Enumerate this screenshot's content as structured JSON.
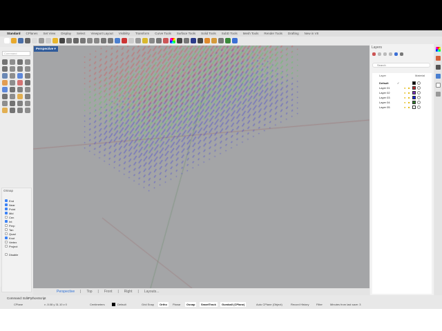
{
  "tabs": [
    "Standard",
    "CPlanes",
    "Set View",
    "Display",
    "Select",
    "Viewport Layout",
    "Visibility",
    "Transform",
    "Curve Tools",
    "Surface Tools",
    "Solid Tools",
    "SubD Tools",
    "Mesh Tools",
    "Render Tools",
    "Drafting",
    "New in V8"
  ],
  "command_placeholder": "Command",
  "viewport": {
    "label": "Perspective ▾",
    "tabs": [
      "Perspective",
      "Top",
      "Front",
      "Right",
      "Layouts..."
    ]
  },
  "osnap": {
    "title": "OSnap",
    "items": [
      {
        "label": "End",
        "on": true
      },
      {
        "label": "Near",
        "on": true
      },
      {
        "label": "Point",
        "on": true
      },
      {
        "label": "Mid",
        "on": true
      },
      {
        "label": "Cen",
        "on": false
      },
      {
        "label": "Int",
        "on": true
      },
      {
        "label": "Perp",
        "on": false
      },
      {
        "label": "Tan",
        "on": false
      },
      {
        "label": "Quad",
        "on": false
      },
      {
        "label": "Knot",
        "on": true
      },
      {
        "label": "Vertex",
        "on": false
      },
      {
        "label": "Project",
        "on": false
      }
    ],
    "disable": "Disable"
  },
  "layers": {
    "title": "Layers",
    "search_placeholder": "Search",
    "col_layer": "Layer",
    "col_material": "Material",
    "rows": [
      {
        "name": "Default",
        "color": "#000000",
        "current": true
      },
      {
        "name": "Layer 01",
        "color": "#c0282c"
      },
      {
        "name": "Layer 02",
        "color": "#7b2fbf"
      },
      {
        "name": "Layer 03",
        "color": "#1020e0"
      },
      {
        "name": "Layer 04",
        "color": "#2f7a2a"
      },
      {
        "name": "Layer 05",
        "color": "#ffffff"
      }
    ]
  },
  "command_line": "Command: EditPythonScript",
  "status": {
    "cplane": "CPlane",
    "coords": "x -5.08  y 31.10  z 0",
    "units": "Centimeters",
    "layer": "Default",
    "grid_snap": "Grid Snap",
    "ortho": "Ortho",
    "planar": "Planar",
    "osnap": "Osnap",
    "smarttrack": "SmartTrack",
    "gumball": "Gumball (CPlane)",
    "auto_cplane": "Auto CPlane (Object)",
    "record_history": "Record History",
    "filter": "Filter",
    "minutes": "Minutes from last save: 3"
  }
}
